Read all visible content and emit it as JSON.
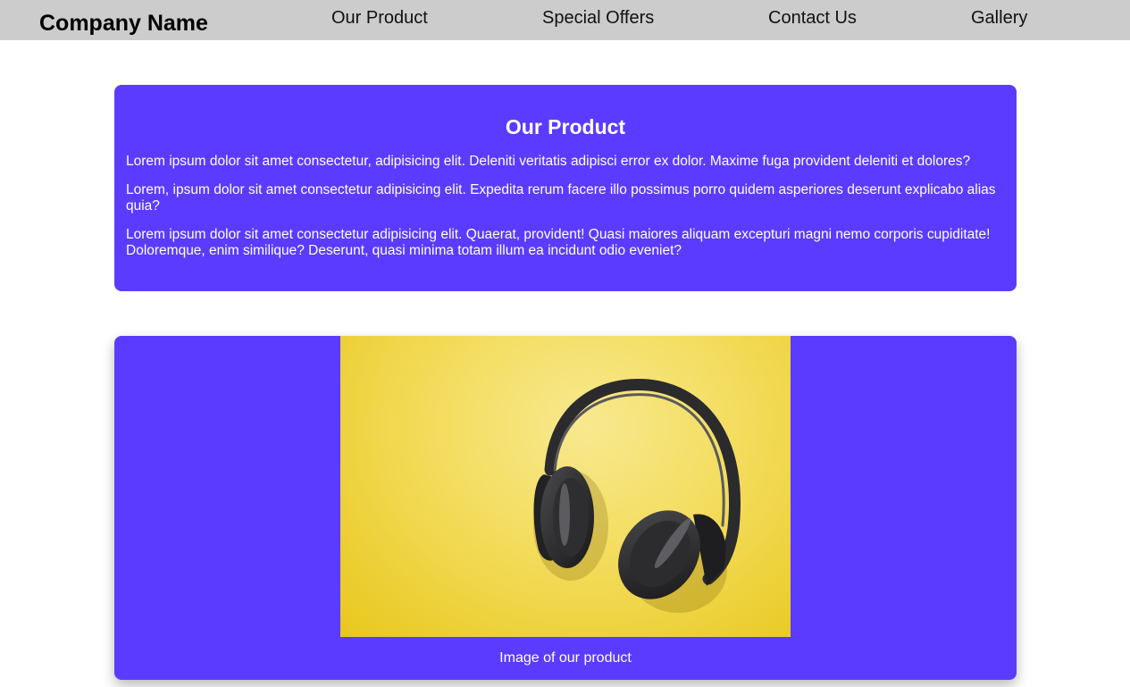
{
  "navbar": {
    "brand": "Company Name",
    "links": [
      "Our Product",
      "Special Offers",
      "Contact Us",
      "Gallery"
    ]
  },
  "product_section": {
    "title": "Our Product",
    "paragraphs": [
      "Lorem ipsum dolor sit amet consectetur, adipisicing elit. Deleniti veritatis adipisci error ex dolor. Maxime fuga provident deleniti et dolores?",
      "Lorem, ipsum dolor sit amet consectetur adipisicing elit. Expedita rerum facere illo possimus porro quidem asperiores deserunt explicabo alias quia?",
      "Lorem ipsum dolor sit amet consectetur adipisicing elit. Quaerat, provident! Quasi maiores aliquam excepturi magni nemo corporis cupiditate! Doloremque, enim similique? Deserunt, quasi minima totam illum ea incidunt odio eveniet?"
    ]
  },
  "image_section": {
    "image_subject": "headphones-on-yellow-background",
    "caption": "Image of our product"
  },
  "colors": {
    "navbar_bg": "#cccccc",
    "card_bg": "#5b3bff",
    "card_text": "#ffffff",
    "photo_bg": "#f3dc5c"
  }
}
